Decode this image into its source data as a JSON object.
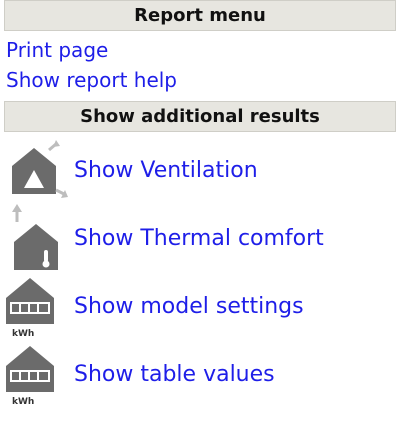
{
  "header": {
    "title": "Report menu"
  },
  "links": [
    {
      "label": "Print page"
    },
    {
      "label": "Show report help"
    }
  ],
  "section": {
    "title": "Show additional results"
  },
  "items": [
    {
      "label": "Show Ventilation",
      "icon": "ventilation-icon"
    },
    {
      "label": "Show Thermal comfort",
      "icon": "thermal-comfort-icon"
    },
    {
      "label": "Show model settings",
      "icon": "meter-kwh-icon",
      "icon_text": "kWh"
    },
    {
      "label": "Show table values",
      "icon": "meter-kwh-icon",
      "icon_text": "kWh"
    }
  ],
  "colors": {
    "link": "#1e1ee8",
    "header_bg": "#e7e6e0",
    "icon_gray": "#6b6b6b"
  }
}
